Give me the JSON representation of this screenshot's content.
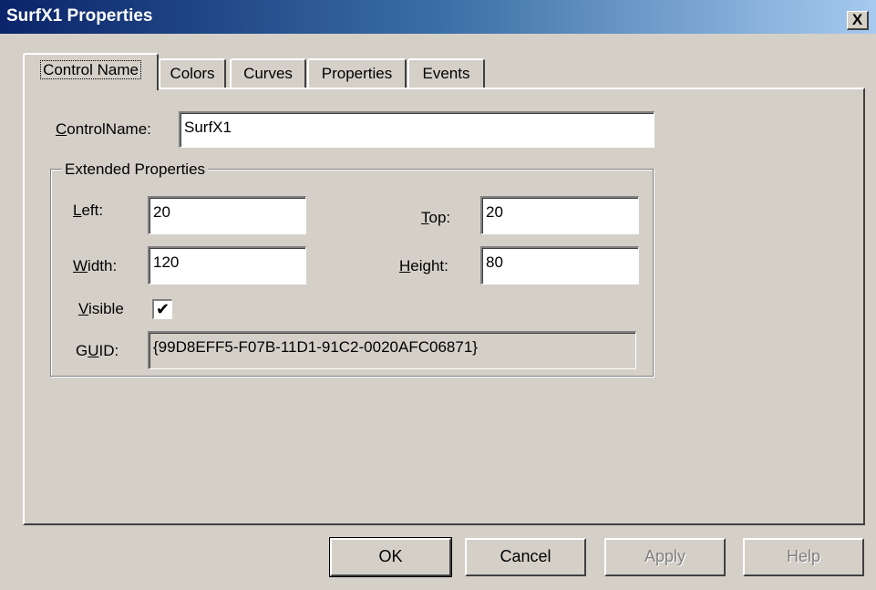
{
  "window": {
    "title": "SurfX1 Properties",
    "close_glyph": "X"
  },
  "tabs": [
    {
      "label": "Control Name",
      "active": true
    },
    {
      "label": "Colors"
    },
    {
      "label": "Curves"
    },
    {
      "label": "Properties"
    },
    {
      "label": "Events"
    }
  ],
  "control_name": {
    "label_hot": "C",
    "label_rest": "ontrolName:",
    "value": "SurfX1"
  },
  "extended": {
    "title": "Extended Properties",
    "left": {
      "label_hot": "L",
      "label_rest": "eft:",
      "value": "20"
    },
    "top": {
      "label_hot": "T",
      "label_rest": "op:",
      "value": "20"
    },
    "width": {
      "label_hot": "W",
      "label_rest": "idth:",
      "value": "120"
    },
    "height": {
      "label_hot": "H",
      "label_rest": "eight:",
      "value": "80"
    },
    "visible": {
      "label_hot": "V",
      "label_rest": "isible",
      "checked": true,
      "check_glyph": "✔"
    },
    "guid": {
      "label_pre": "G",
      "label_hot": "U",
      "label_rest": "ID:",
      "value": "{99D8EFF5-F07B-11D1-91C2-0020AFC06871}"
    }
  },
  "buttons": {
    "ok": "OK",
    "cancel": "Cancel",
    "apply": "Apply",
    "help": "Help"
  },
  "colors": {
    "title_start": "#0a246a",
    "title_end": "#a6caf0",
    "face": "#d4d0c8",
    "disabled_text": "#808080"
  }
}
